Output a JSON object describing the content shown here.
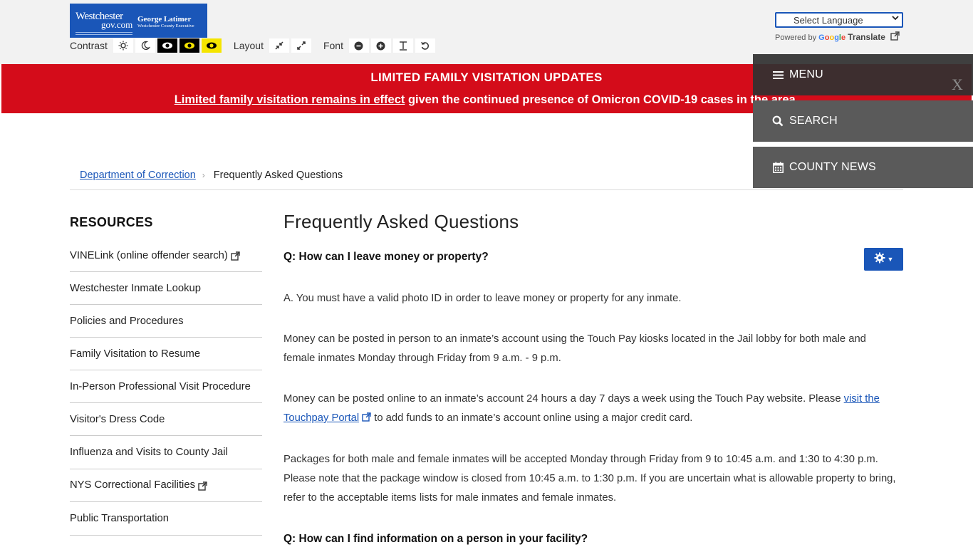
{
  "header": {
    "logo": {
      "site": "Westchester",
      "site_domain": "gov.com",
      "exec_name": "George Latimer",
      "exec_title": "Westchester County Executive"
    },
    "accessibility": {
      "contrast_label": "Contrast",
      "layout_label": "Layout",
      "font_label": "Font"
    },
    "language": {
      "selected": "Select Language",
      "powered_by": "Powered by",
      "google": "Google",
      "translate": "Translate"
    }
  },
  "alert": {
    "title": "LIMITED FAMILY VISITATION UPDATES",
    "link_text": "Limited family visitation remains in effect",
    "message_rest": " given the continued presence of Omicron COVID-19 cases in the area."
  },
  "overlay_menu": {
    "menu_label": "MENU",
    "search_label": "SEARCH",
    "news_label": "COUNTY NEWS",
    "close_label": "X"
  },
  "breadcrumb": {
    "parent": "Department of Correction",
    "current": "Frequently Asked Questions"
  },
  "sidebar": {
    "title": "RESOURCES",
    "items": [
      {
        "label": "VINELink (online offender search)",
        "external": true
      },
      {
        "label": "Westchester Inmate Lookup",
        "external": false
      },
      {
        "label": "Policies and Procedures",
        "external": false
      },
      {
        "label": "Family Visitation to Resume",
        "external": false
      },
      {
        "label": "In-Person Professional Visit Procedure",
        "external": false
      },
      {
        "label": "Visitor's Dress Code",
        "external": false
      },
      {
        "label": "Influenza and Visits to County Jail",
        "external": false
      },
      {
        "label": "NYS Correctional Facilities",
        "external": true
      },
      {
        "label": "Public Transportation",
        "external": false
      }
    ]
  },
  "main": {
    "title": "Frequently Asked Questions",
    "q1": "Q: How can I leave money or property?",
    "a1": "A. You must have a valid photo ID in order to leave money or property for any inmate.",
    "p2": "Money can be posted in person to an inmate’s account using the Touch Pay kiosks located in the Jail lobby for both male and female inmates Monday through Friday from 9 a.m. - 9 p.m.",
    "p3_before": "Money can be posted online to an inmate’s account 24 hours a day 7 days a week using the Touch Pay website. Please ",
    "p3_link": "visit the Touchpay Portal",
    "p3_after": " to add funds to an inmate’s account online using a major credit card.",
    "p4": "Packages for both male and female inmates will be accepted Monday through Friday from 9 to 10:45 a.m. and 1:30 to 4:30 p.m. Please note that the package window is closed from 10:45 a.m. to 1:30 p.m. If you are uncertain what is allowable property to bring, refer to the acceptable items lists for male inmates and female inmates.",
    "q2": "Q: How can I find information on a person in your facility?"
  },
  "colors": {
    "brand_blue": "#1a56b8",
    "alert_red": "#d40c1a",
    "overlay_gray": "#5a5a5a"
  }
}
